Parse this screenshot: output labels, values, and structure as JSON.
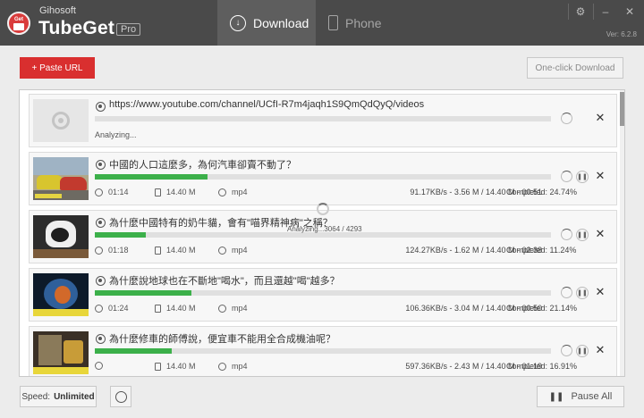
{
  "app": {
    "company": "Gihosoft",
    "name": "TubeGet",
    "edition": "Pro",
    "version": "Ver: 6.2.8",
    "logo_text": "Get Tube"
  },
  "tabs": [
    {
      "label": "Download",
      "active": true,
      "icon": "download-icon"
    },
    {
      "label": "Phone",
      "active": false,
      "icon": "phone-icon"
    }
  ],
  "window_controls": {
    "settings": "⚙",
    "minimize": "–",
    "close": "✕"
  },
  "toolbar": {
    "paste_label": "+ Paste URL",
    "oneclick_label": "One-click Download"
  },
  "overlay": {
    "analyzing_text": "Analyzing...3064 / 4293"
  },
  "items": [
    {
      "title": "https://www.youtube.com/channel/UCfI-R7m4jaqh1S9QmQdQyQ/videos",
      "status": "Analyzing...",
      "progress": 0,
      "type": "url"
    },
    {
      "title": "中國的人口這麼多，為何汽車卻賣不動了？",
      "duration": "01:14",
      "size": "14.40 M",
      "format": "mp4",
      "speed": "91.17KB/s - 3.56 M / 14.40 M - 00:51",
      "completed": "Completed:  24.74%",
      "progress": 24.74
    },
    {
      "title": "為什麼中國特有的奶牛貓，會有\"喵界精神病\"之稱？",
      "duration": "01:18",
      "size": "14.40 M",
      "format": "mp4",
      "speed": "124.27KB/s - 1.62 M / 14.40 M - 02:38",
      "completed": "Completed:  11.24%",
      "progress": 11.24
    },
    {
      "title": "為什麼說地球也在不斷地\"喝水\"，而且還越\"喝\"越多？",
      "duration": "01:24",
      "size": "14.40 M",
      "format": "mp4",
      "speed": "106.36KB/s - 3.04 M / 14.40 M - 00:50",
      "completed": "Completed:  21.14%",
      "progress": 21.14
    },
    {
      "title": "為什麼修車的師傅說，便宜車不能用全合成機油呢？",
      "duration": "",
      "size": "14.40 M",
      "format": "mp4",
      "speed": "597.36KB/s - 2.43 M / 14.40 M - 01:19",
      "completed": "Completed:  16.91%",
      "progress": 16.91
    }
  ],
  "footer": {
    "speed_label": "Speed:",
    "speed_value": "Unlimited",
    "pause_all_label": "Pause All"
  },
  "colors": {
    "accent": "#d92f2f",
    "progress": "#3cb04a",
    "header": "#4a4a4a"
  }
}
